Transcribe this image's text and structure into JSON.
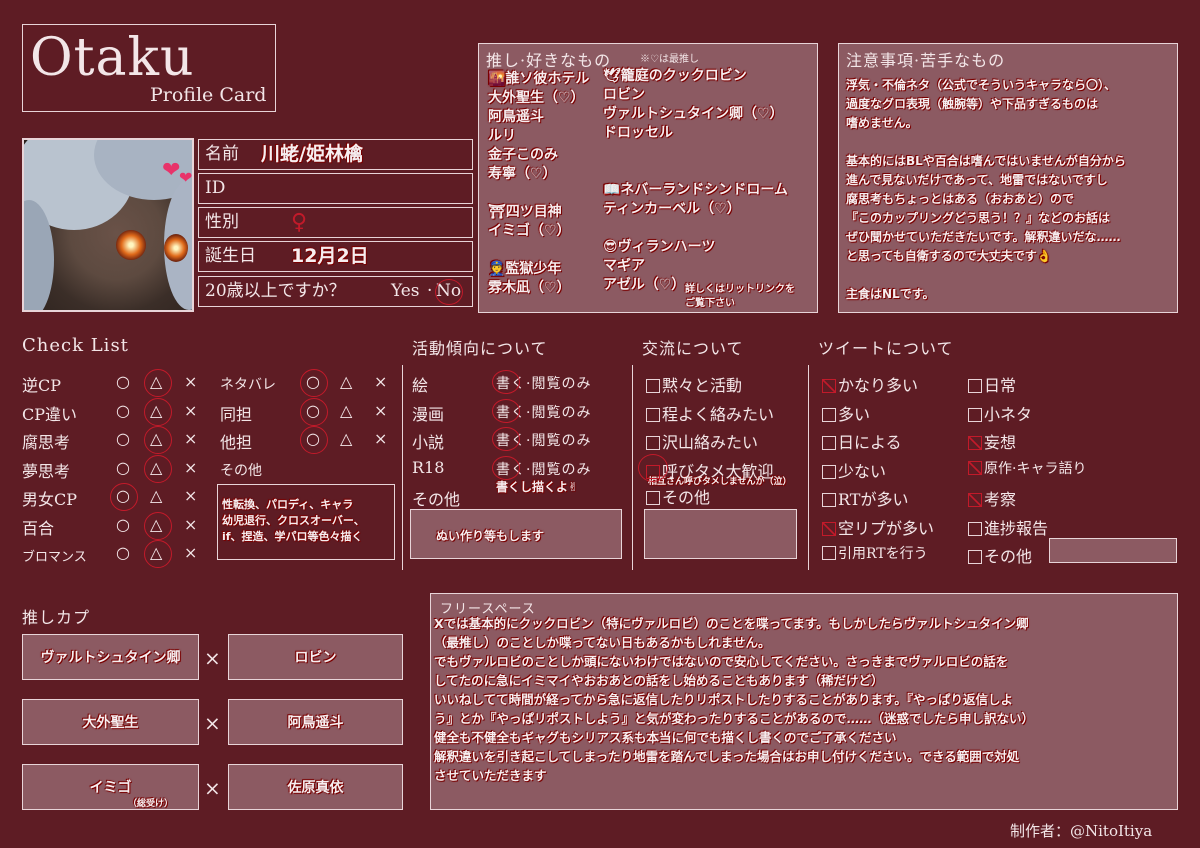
{
  "title": {
    "main": "Otaku",
    "sub": "Profile Card"
  },
  "profile": {
    "name_label": "名前",
    "name_value": "川蛯/姫林檎",
    "id_label": "ID",
    "id_value": "",
    "gender_label": "性別",
    "gender_value": "♀",
    "birthday_label": "誕生日",
    "birthday_value": "12月2日",
    "age_label": "20歳以上ですか？",
    "age_yes": "Yes",
    "age_sep": "·",
    "age_no": "No"
  },
  "oshi": {
    "title": "推し·好きなもの",
    "note": "※♡は最推し",
    "col1": [
      "🌇誰ソ彼ホテル",
      "大外聖生（♡）",
      "阿鳥遥斗",
      "ルリ",
      "金子このみ",
      "寿寧（♡）",
      "",
      "⛩四ツ目神",
      "イミゴ（♡）",
      "",
      "👮監獄少年",
      "雰木凪（♡）"
    ],
    "col2": [
      "🕊籠庭のクックロビン",
      "ロビン",
      "ヴァルトシュタイン卿（♡）",
      "ドロッセル",
      "",
      "",
      "📖ネバーランドシンドローム",
      "ティンカーベル（♡）",
      "",
      "😎ヴィランハーツ",
      "マギア",
      "アゼル（♡）"
    ],
    "footnote1": "詳しくはリットリンクを",
    "footnote2": "ご覧下さい"
  },
  "caution": {
    "title": "注意事項·苦手なもの",
    "lines": [
      "浮気・不倫ネタ（公式でそういうキャラなら〇）、",
      "過度なグロ表現（触腕等）や下品すぎるものは",
      "嗜めません。",
      "",
      "基本的にはBLや百合は嗜んではいませんが自分から",
      "進んで見ないだけであって、地雷ではないですし",
      "腐思考もちょっとはある（おおあと）ので",
      "『このカップリングどう思う！？』などのお話は",
      "ぜひ聞かせていただきたいです。解釈違いだな……",
      "と思っても自衛するので大丈夫です👌",
      "",
      "主食はNLです。"
    ]
  },
  "checklist": {
    "title": "Check List",
    "marks": [
      "○",
      "△",
      "×"
    ],
    "left": [
      "逆CP",
      "CP違い",
      "腐思考",
      "夢思考",
      "男女CP",
      "百合",
      "ブロマンス"
    ],
    "right": [
      "ネタバレ",
      "同担",
      "他担",
      "その他"
    ],
    "other_text": [
      "性転換、パロディ、キャラ",
      "幼児退行、クロスオーバー、",
      "if、捏造、学パロ等色々描く"
    ]
  },
  "activity": {
    "title": "活動傾向について",
    "rows": [
      "絵",
      "漫画",
      "小説",
      "R18"
    ],
    "option": "書く·閲覧のみ",
    "note": "書くし描くよ✌",
    "other_label": "その他",
    "other_text": "ぬい作り等もします"
  },
  "exchange": {
    "title": "交流について",
    "items": [
      "黙々と活動",
      "程よく絡みたい",
      "沢山絡みたい",
      "呼びタメ大歓迎"
    ],
    "note": "相互さん呼びタメしませんか（泣）",
    "other_label": "その他"
  },
  "tweet": {
    "title": "ツイートについて",
    "col1": [
      "かなり多い",
      "多い",
      "日による",
      "少ない",
      "RTが多い",
      "空リプが多い",
      "引用RTを行う"
    ],
    "col2": [
      "日常",
      "小ネタ",
      "妄想",
      "原作·キャラ語り",
      "考察",
      "進捗報告",
      "その他"
    ]
  },
  "cp": {
    "title": "推しカプ",
    "pairs": [
      {
        "left": "ヴァルトシュタイン卿",
        "right": "ロビン"
      },
      {
        "left": "大外聖生",
        "right": "阿鳥遥斗"
      },
      {
        "left": "イミゴ",
        "left_note": "（総受け）",
        "right": "佐原真依"
      }
    ],
    "cross": "×"
  },
  "free": {
    "title": "フリースペース",
    "lines": [
      "Xでは基本的にクックロビン（特にヴァルロビ）のことを喋ってます。もしかしたらヴァルトシュタイン卿",
      "（最推し）のことしか喋ってない日もあるかもしれません。",
      "でもヴァルロビのことしか頭にないわけではないので安心してください。さっきまでヴァルロビの話を",
      "してたのに急にイミマイやおおあとの話をし始めることもあります（稀だけど）",
      "いいねしてて時間が経ってから急に返信したりリポストしたりすることがあります。『やっぱり返信しよ",
      "う』とか『やっぱリポストしよう』と気が変わったりすることがあるので……（迷惑でしたら申し訳ない）",
      "健全も不健全もギャグもシリアス系も本当に何でも描くし書くのでご了承ください",
      "解釈違いを引き起こしてしまったり地雷を踏んでしまった場合はお申し付けください。できる範囲で対処",
      "させていただきます"
    ]
  },
  "credit": "制作者：@NitoItiya"
}
